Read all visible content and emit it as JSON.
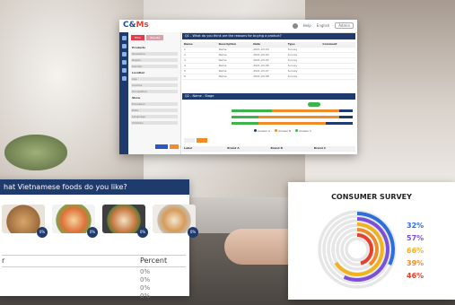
{
  "app": {
    "logo_a": "C&",
    "logo_b": "Ms",
    "top_right": {
      "help": "Help",
      "english": "English",
      "user": "Admin"
    },
    "left_panel": {
      "tab_active": "Filter",
      "tab_inactive": "Results",
      "rows": [
        "Products",
        "Questions",
        "Region",
        "Gender",
        "Location",
        "Age",
        "Income",
        "Occupation",
        "Show",
        "Education",
        "Date",
        "Language",
        "Children",
        "Segment"
      ]
    },
    "question_header": "Q1 - What do you think are the reasons for buying a product?",
    "table_headers": [
      "Name",
      "Description",
      "Date",
      "Type",
      "Comment"
    ],
    "table_rows": [
      [
        "1",
        "Name",
        "2021-03-03",
        "Survey",
        ""
      ],
      [
        "2",
        "Name",
        "2021-03-04",
        "Survey",
        ""
      ],
      [
        "3",
        "Name",
        "2021-03-05",
        "Survey",
        ""
      ],
      [
        "4",
        "Name",
        "2021-03-06",
        "Survey",
        ""
      ],
      [
        "5",
        "Name",
        "2021-03-07",
        "Survey",
        ""
      ],
      [
        "6",
        "Name",
        "2021-03-08",
        "Survey",
        ""
      ]
    ],
    "chart_header": "Q2 - Name - Stage",
    "legend": [
      "Answer A",
      "Answer B",
      "Answer C"
    ],
    "bottom_table_headers": [
      "Label",
      "Brand A",
      "Brand B",
      "Brand C"
    ],
    "bottom_table_rows": [
      [
        "",
        "",
        "",
        ""
      ],
      [
        "",
        "",
        "",
        ""
      ]
    ],
    "colors": {
      "navy": "#1f3b6e",
      "red": "#e33a4d",
      "orange": "#f08a2a",
      "green": "#3cb44b",
      "blue": "#2a56c6"
    }
  },
  "poll": {
    "title": "hat Vietnamese foods do you like?",
    "badges": [
      "0%",
      "0%",
      "0%",
      "0%"
    ],
    "col_option": "r",
    "col_percent": "Percent",
    "percents": [
      "0%",
      "0%",
      "0%",
      "0%"
    ]
  },
  "survey": {
    "title": "CONSUMER SURVEY",
    "chart_data": {
      "type": "radial-bar",
      "values": [
        32,
        57,
        66,
        39,
        46
      ],
      "labels": [
        "32%",
        "57%",
        "66%",
        "39%",
        "46%"
      ],
      "colors": [
        "#2a6fdb",
        "#7b4fd8",
        "#f2b21b",
        "#f08a2a",
        "#e5402a"
      ]
    }
  }
}
